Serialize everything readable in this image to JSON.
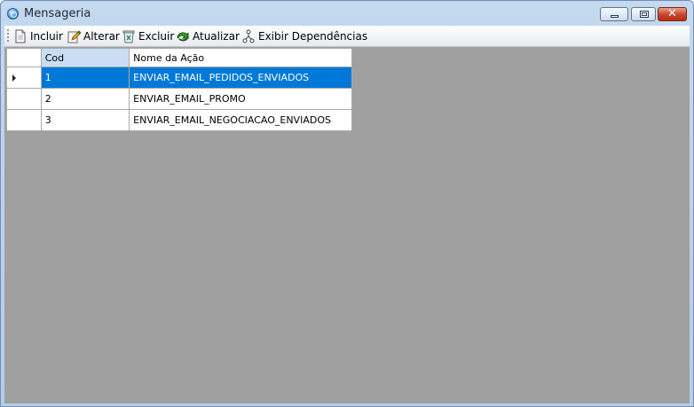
{
  "window": {
    "title": "Mensageria"
  },
  "toolbar": {
    "items": [
      {
        "label": "Incluir",
        "icon": "new-document-icon"
      },
      {
        "label": "Alterar",
        "icon": "edit-pencil-icon"
      },
      {
        "label": "Excluir",
        "icon": "delete-bin-icon"
      },
      {
        "label": "Atualizar",
        "icon": "refresh-icon"
      },
      {
        "label": "Exibir Dependências",
        "icon": "dependency-tree-icon"
      }
    ]
  },
  "grid": {
    "columns": [
      "Cod",
      "Nome da Ação"
    ],
    "rows": [
      {
        "cod": "1",
        "nome": "ENVIAR_EMAIL_PEDIDOS_ENVIADOS",
        "selected": true
      },
      {
        "cod": "2",
        "nome": "ENVIAR_EMAIL_PROMO",
        "selected": false
      },
      {
        "cod": "3",
        "nome": "ENVIAR_EMAIL_NEGOCIACAO_ENVIADOS",
        "selected": false
      }
    ]
  },
  "colors": {
    "selection": "#0078d7",
    "workspace": "#a0a0a0",
    "header_selected": "#c9def5"
  }
}
